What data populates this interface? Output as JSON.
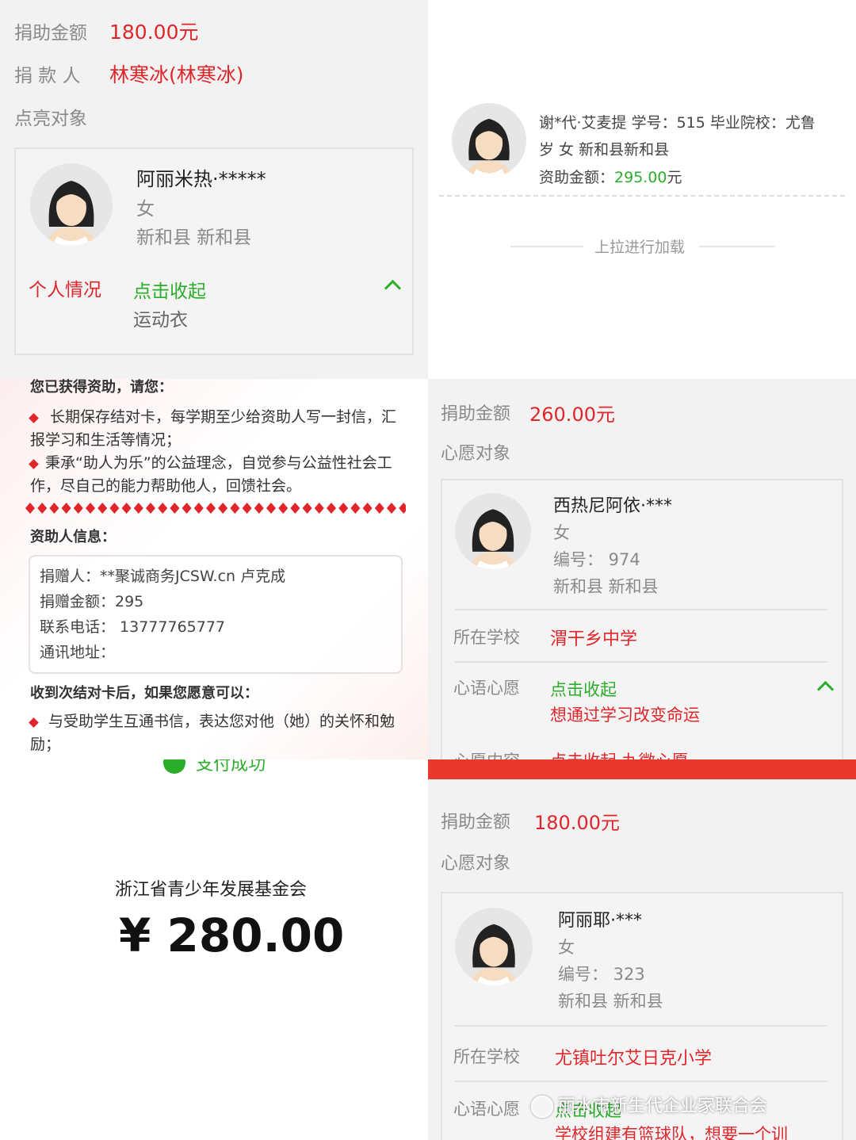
{
  "p1": {
    "amount_label": "捐助金额",
    "amount_value": "180.00元",
    "donor_label": "捐 款 人",
    "donor_value": "林寒冰(林寒冰)",
    "target_label": "点亮对象",
    "student": {
      "name": "阿丽米热·*****",
      "gender": "女",
      "location": "新和县 新和县"
    },
    "situation_label": "个人情况",
    "collapse": "点击收起",
    "wish": "运动衣"
  },
  "p2": {
    "info_line1": "谢*代·艾麦提 学号：515 毕业院校：尤鲁",
    "info_line2": "岁 女 新和县新和县",
    "funding_label": "资助金额：",
    "funding_value": "295.00",
    "funding_unit": "元",
    "load_more": "上拉进行加载"
  },
  "p3": {
    "cut_heading": "您已获得资助，请您：",
    "bullet1": "长期保存结对卡，每学期至少给资助人写一封信，汇报学习和生活等情况；",
    "bullet2": "秉承“助人为乐”的公益理念，自觉参与公益性社会工作，尽自己的能力帮助他人，回馈社会。",
    "sponsor_heading": "资助人信息：",
    "sponsor_lines": [
      "捐赠人：**聚诚商务JCSW.cn 卢克成",
      "捐赠金额：295",
      "联系电话： 13777765777",
      "通讯地址："
    ],
    "after_heading": "收到次结对卡后，如果您愿意可以：",
    "bullet3": "与受助学生互通书信，表达您对他（她）的关怀和勉励；"
  },
  "p4": {
    "amount_label": "捐助金额",
    "amount_value": "260.00元",
    "target_label": "心愿对象",
    "student": {
      "name": "西热尼阿依·***",
      "gender": "女",
      "id": "编号：  974",
      "location": "新和县 新和县"
    },
    "school_label": "所在学校",
    "school_value": "渭干乡中学",
    "wish_label": "心语心愿",
    "collapse": "点击收起",
    "wish_text": "想通过学习改变命运",
    "cut_label": "心愿内容",
    "cut_value": "点击收起 九微心愿"
  },
  "p5": {
    "cut_text": "支付成功",
    "org": "浙江省青少年发展基金会",
    "amount": "¥ 280.00"
  },
  "p6": {
    "amount_label": "捐助金额",
    "amount_value": "180.00元",
    "target_label": "心愿对象",
    "student": {
      "name": "阿丽耶·***",
      "gender": "女",
      "id": "编号：  323",
      "location": "新和县 新和县"
    },
    "school_label": "所在学校",
    "school_value": "尤镇吐尔艾日克小学",
    "wish_label": "心语心愿",
    "collapse": "点击收起",
    "wish_text": "学校组建有篮球队，想要一个训",
    "watermark": "丽水市新生代企业家联合会"
  },
  "colors": {
    "accent_red": "#e0262b",
    "accent_green": "#2aae2a",
    "bar_red": "#e8392c"
  }
}
